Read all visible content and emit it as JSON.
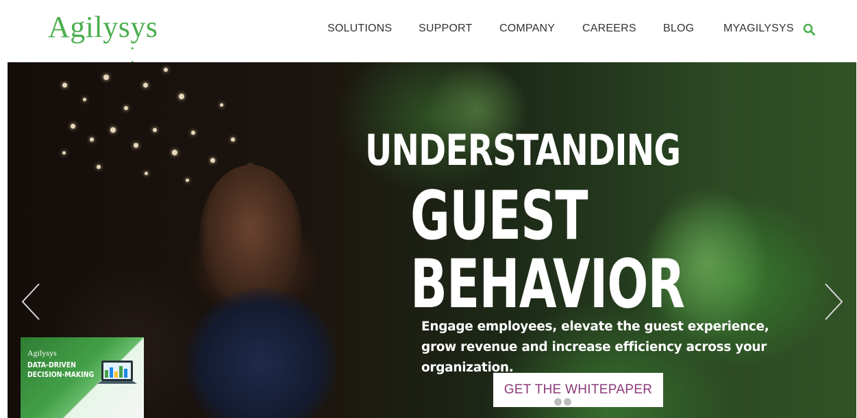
{
  "brand": {
    "name": "Agilysys",
    "dots": ". . . . .",
    "accent": "#4caf50"
  },
  "nav": {
    "items": [
      {
        "label": "SOLUTIONS"
      },
      {
        "label": "SUPPORT"
      },
      {
        "label": "COMPANY"
      },
      {
        "label": "CAREERS"
      },
      {
        "label": "BLOG"
      },
      {
        "label": "MYAGILYSYS"
      }
    ],
    "search_icon": "search-icon"
  },
  "hero": {
    "headline_line1": "UNDERSTANDING",
    "headline_line2": "GUEST",
    "headline_line3": "BEHAVIOR",
    "subtext": "Engage employees, elevate the guest experience, grow revenue and increase efficiency across your organization.",
    "cta_label": "GET THE WHITEPAPER",
    "cta_color": "#8b3a7a",
    "prev_icon": "chevron-left-icon",
    "next_icon": "chevron-right-icon",
    "slide_count": 2,
    "promo": {
      "logo": "Agilysys",
      "title_line1": "DATA-DRIVEN",
      "title_line2": "DECISION-MAKING"
    }
  }
}
